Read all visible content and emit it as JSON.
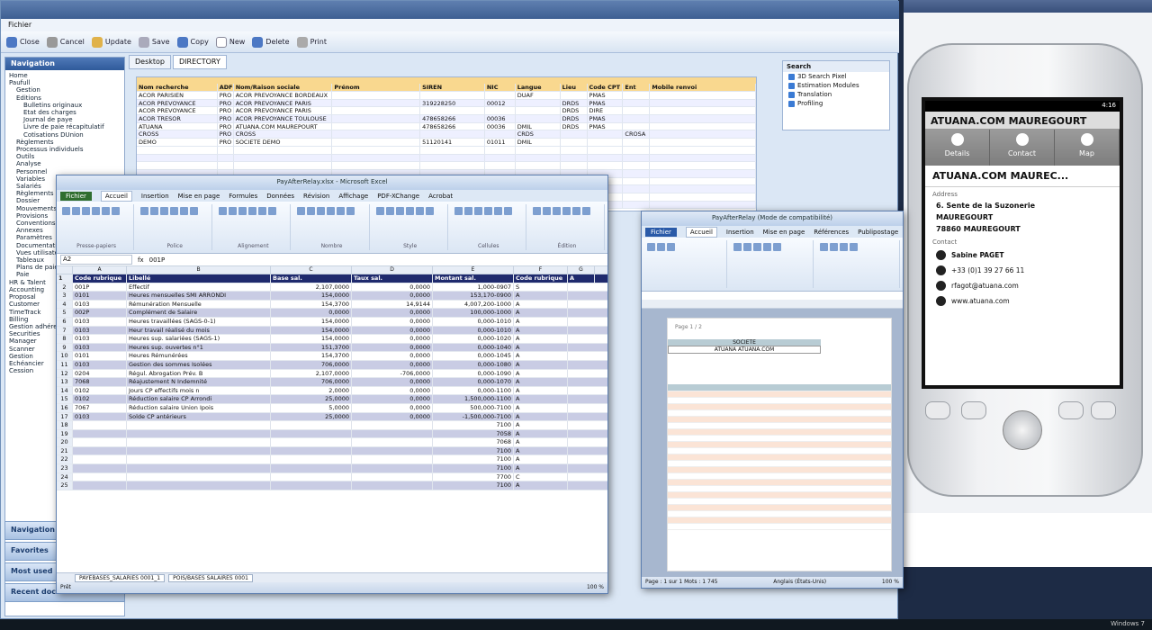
{
  "app": {
    "title": "",
    "menu": "Fichier",
    "toolbar": [
      "Close",
      "Cancel",
      "Update",
      "Save",
      "Copy",
      "New",
      "Delete",
      "Print"
    ],
    "nav_header": "Navigation",
    "tree": [
      "Home",
      "Paufull",
      "Gestion",
      "Editions",
      "Bulletins originaux",
      "Etat des charges",
      "Journal de paye",
      "Livre de paie récapitulatif",
      "Cotisations DUnion",
      "Règlements",
      "Processus individuels",
      "Outils",
      "Analyse",
      "Personnel",
      "Variables",
      "Salariés",
      "Règlements",
      "Dossier",
      "Mouvements",
      "Provisions",
      "Conventions",
      "Annexes",
      "Paramètres",
      "Documentations",
      "Vues utilisateur",
      "Tableaux",
      "Plans de paie",
      "Paie",
      "HR & Talent",
      "Accounting",
      "Proposal",
      "Customer",
      "TimeTrack",
      "Billing",
      "Gestion adhérents",
      "Securities",
      "Manager",
      "Scanner",
      "Gestion",
      "Echéancier",
      "Cession"
    ],
    "nav_bottom": [
      "Navigation",
      "Favorites",
      "Most used",
      "Recent documents"
    ],
    "tabs": [
      "Desktop",
      "DIRECTORY"
    ],
    "grid_headers": [
      "Nom recherche",
      "ADF",
      "Nom/Raison sociale",
      "Prénom",
      "SIREN",
      "NIC",
      "Langue",
      "Lieu",
      "Code CPT",
      "Ent",
      "Mobile renvoi"
    ],
    "grid_rows": [
      [
        "ACOR PARISIEN",
        "PRO",
        "ACOR PREVOYANCE BORDEAUX",
        "",
        "",
        "",
        "DUAF",
        "",
        "PMAS",
        "",
        ""
      ],
      [
        "ACOR PREVOYANCE",
        "PRO",
        "ACOR PREVOYANCE PARIS",
        "",
        "319228250",
        "00012",
        "",
        "DRDS",
        "PMAS",
        "",
        ""
      ],
      [
        "ACOR PREVOYANCE",
        "PRO",
        "ACOR PREVOYANCE PARIS",
        "",
        "",
        "",
        "",
        "DRDS",
        "DIRE",
        "",
        ""
      ],
      [
        "ACOR TRESOR",
        "PRO",
        "ACOR PREVOYANCE TOULOUSE",
        "",
        "478658266",
        "00036",
        "",
        "DRDS",
        "PMAS",
        "",
        ""
      ],
      [
        "ATUANA",
        "PRO",
        "ATUANA.COM MAUREPOURT",
        "",
        "478658266",
        "00036",
        "DMIL",
        "DRDS",
        "PMAS",
        "",
        ""
      ],
      [
        "CROSS",
        "PRO",
        "CROSS",
        "",
        "",
        "",
        "CRDS",
        "",
        "",
        "CROSA",
        ""
      ],
      [
        "DEMO",
        "PRO",
        "SOCIETE DEMO",
        "",
        "51120141",
        "01011",
        "DMIL",
        "",
        "",
        "",
        ""
      ]
    ],
    "right_panel": {
      "title": "Search",
      "items": [
        "3D Search Pixel",
        "Estimation Modules",
        "Translation",
        "Profiling"
      ]
    }
  },
  "excel": {
    "title": "PayAfterRelay.xlsx - Microsoft Excel",
    "tabs": [
      "Fichier",
      "Accueil",
      "Insertion",
      "Mise en page",
      "Formules",
      "Données",
      "Révision",
      "Affichage",
      "PDF-XChange",
      "Acrobat"
    ],
    "ribbon_groups": [
      "Presse-papiers",
      "Police",
      "Alignement",
      "Nombre",
      "Style",
      "Cellules",
      "Édition"
    ],
    "namebox": "A2",
    "formula": "001P",
    "col_letters": [
      "",
      "A",
      "B",
      "C",
      "D",
      "E",
      "F",
      "G"
    ],
    "headers": [
      "Code rubrique",
      "Libellé",
      "Base sal.",
      "Taux sal.",
      "Montant sal.",
      "Code rubrique",
      "A"
    ],
    "rows": [
      [
        "2",
        "001P",
        "Effectif",
        "2,107,0000",
        "0,0000",
        "1,000-0907",
        "S"
      ],
      [
        "3",
        "0101",
        "Heures mensuelles SMI ARRONDI",
        "154,0000",
        "0,0000",
        "153,170-0900",
        "A"
      ],
      [
        "4",
        "0103",
        "Rémunération Mensuelle",
        "154,3700",
        "14,9144",
        "4,007,200-1000",
        "A"
      ],
      [
        "5",
        "002P",
        "Complément de Salaire",
        "0,0000",
        "0,0000",
        "100,000-1000",
        "A"
      ],
      [
        "6",
        "0103",
        "Heures travaillées (SAGS-0-1)",
        "154,0000",
        "0,0000",
        "0,000-1010",
        "A"
      ],
      [
        "7",
        "0103",
        "Heur travail réalisé du mois",
        "154,0000",
        "0,0000",
        "0,000-1010",
        "A"
      ],
      [
        "8",
        "0103",
        "Heures sup. salariées (SAGS-1)",
        "154,0000",
        "0,0000",
        "0,000-1020",
        "A"
      ],
      [
        "9",
        "0103",
        "Heures sup. ouvertes n°1",
        "151,3700",
        "0,0000",
        "0,000-1040",
        "A"
      ],
      [
        "10",
        "0101",
        "Heures Rémunérées",
        "154,3700",
        "0,0000",
        "0,000-1045",
        "A"
      ],
      [
        "11",
        "0103",
        "Gestion des sommes Isolées",
        "706,0000",
        "0,0000",
        "0,000-1080",
        "A"
      ],
      [
        "12",
        "0204",
        "Régul. Abrogation Prév. B",
        "2,107,0000",
        "-706,0000",
        "0,000-1090",
        "A"
      ],
      [
        "13",
        "7068",
        "Réajustement N Indemnité",
        "706,0000",
        "0,0000",
        "0,000-1070",
        "A"
      ],
      [
        "14",
        "0102",
        "Jours CP effectifs mois n",
        "2,0000",
        "0,0000",
        "0,000-1100",
        "A"
      ],
      [
        "15",
        "0102",
        "Réduction salaire CP Arrondi",
        "25,0000",
        "0,0000",
        "1,500,000-1100",
        "A"
      ],
      [
        "16",
        "7067",
        "Réduction salaire Union Ipois",
        "5,0000",
        "0,0000",
        "500,000-7100",
        "A"
      ],
      [
        "17",
        "0103",
        "Solde CP antérieurs",
        "25,0000",
        "0,0000",
        "-1,500,000-7100",
        "A"
      ]
    ],
    "empty_rows": [
      [
        "18",
        "",
        "",
        "",
        "",
        "7100",
        "A"
      ],
      [
        "19",
        "",
        "",
        "",
        "",
        "7058",
        "A"
      ],
      [
        "20",
        "",
        "",
        "",
        "",
        "7068",
        "A"
      ],
      [
        "21",
        "",
        "",
        "",
        "",
        "7100",
        "A"
      ],
      [
        "22",
        "",
        "",
        "",
        "",
        "7100",
        "A"
      ],
      [
        "23",
        "",
        "",
        "",
        "",
        "7100",
        "A"
      ],
      [
        "24",
        "",
        "",
        "",
        "",
        "7700",
        "C"
      ],
      [
        "25",
        "",
        "",
        "",
        "",
        "7100",
        "A"
      ]
    ],
    "sheets": [
      "PAYEBASES_SALARIES 0001_1",
      "POIS/BASES SALAIRES 0001"
    ],
    "status_left": "Prêt",
    "zoom": "100 %"
  },
  "word": {
    "title": "PayAfterRelay (Mode de compatibilité)",
    "tabs": [
      "Fichier",
      "Accueil",
      "Insertion",
      "Mise en page",
      "Références",
      "Publipostage"
    ],
    "page_header": "Page 1 / 2",
    "company_label": "SOCIETE",
    "company": "ATUANA ATUANA.COM",
    "status_left": "Page : 1 sur 1   Mots : 1 745",
    "status_lang": "Anglais (États-Unis)",
    "zoom": "100 %"
  },
  "phone": {
    "time": "4:16",
    "title": "ATUANA.COM MAUREGOURT",
    "actions": [
      "Details",
      "Contact",
      "Map"
    ],
    "name": "ATUANA.COM MAUREC...",
    "address_label": "Address",
    "address": [
      "6. Sente de la Suzonerie",
      "MAUREGOURT",
      "78860 MAUREGOURT"
    ],
    "contact_label": "Contact",
    "contacts": [
      "Sabine PAGET",
      "+33 (0)1 39 27 66 11",
      "rfagot@atuana.com",
      "www.atuana.com"
    ]
  },
  "taskbar": {
    "right": "Windows 7"
  },
  "colors": {
    "accent": "#3e5f92",
    "grid_header": "#f9d88f",
    "excel_header": "#1f2a6d",
    "excel_band": "#c9cce4"
  }
}
